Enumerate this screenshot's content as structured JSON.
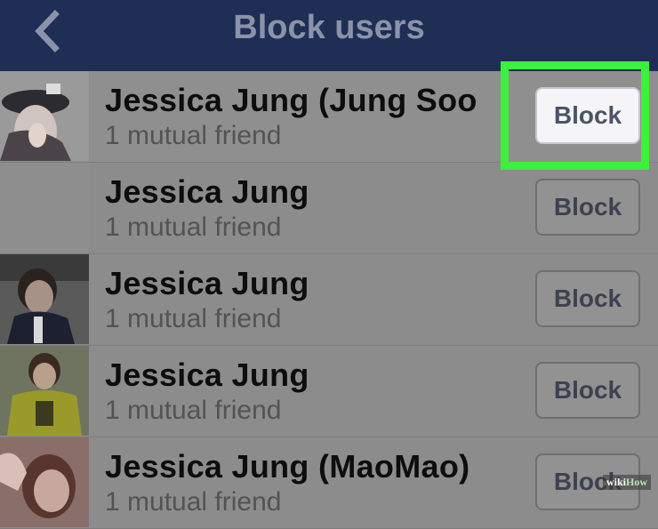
{
  "header": {
    "title": "Block users",
    "back_icon": "chevron-left-icon"
  },
  "users": [
    {
      "name": "Jessica Jung (Jung Soo",
      "mutual": "1 mutual friend",
      "button": "Block",
      "highlighted": true
    },
    {
      "name": "Jessica Jung",
      "mutual": "1 mutual friend",
      "button": "Block",
      "highlighted": false
    },
    {
      "name": "Jessica Jung",
      "mutual": "1 mutual friend",
      "button": "Block",
      "highlighted": false
    },
    {
      "name": "Jessica Jung",
      "mutual": "1 mutual friend",
      "button": "Block",
      "highlighted": false
    },
    {
      "name": "Jessica Jung (MaoMao)",
      "mutual": "1 mutual friend",
      "button": "Block",
      "highlighted": false
    }
  ],
  "colors": {
    "header_bg": "#1f2e55",
    "highlight_border": "#3df03d"
  },
  "watermark": {
    "wiki": "wiki",
    "how": "How"
  }
}
